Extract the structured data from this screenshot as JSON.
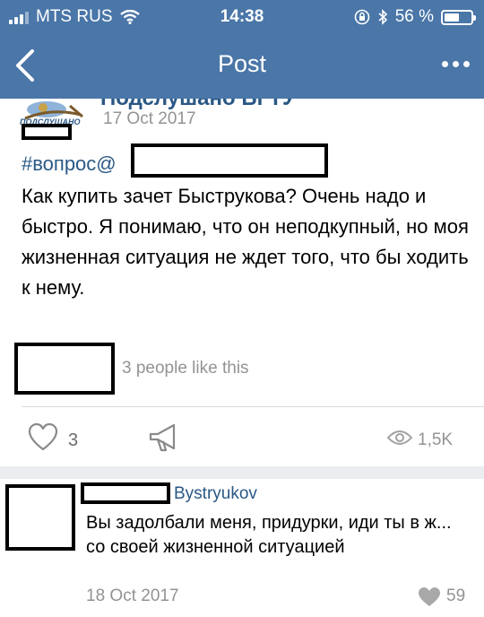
{
  "status_bar": {
    "carrier": "MTS RUS",
    "time": "14:38",
    "battery_percent": "56 %",
    "battery_level": 0.56
  },
  "navbar": {
    "title": "Post"
  },
  "post": {
    "group_name": "Подслушано БГТУ",
    "logo_text": "ПОДСЛУШАНО",
    "date": "17 Oct 2017",
    "hashtag": "#вопрос@",
    "text": "Как купить зачет Быструкова? Очень надо и быстро. Я понимаю, что он неподкупный, но моя жизненная ситуация не ждет того, что бы ходить к нему.",
    "likes_text": "3 people like this",
    "like_count": "3",
    "view_count": "1,5K"
  },
  "comment": {
    "reply_to": "Bystryukov",
    "text": "Вы задолбали меня, придурки, иди ты в ж... со своей жизненной ситуацией",
    "date": "18 Oct 2017",
    "likes": "59"
  },
  "colors": {
    "header": "#4a76a8",
    "link": "#2a5885",
    "muted": "#939393",
    "separator": "#ebedf0"
  },
  "icons": [
    "wifi-icon",
    "lock-rotation-icon",
    "bluetooth-icon",
    "battery-icon",
    "back-icon",
    "more-icon",
    "heart-icon",
    "share-icon",
    "eye-icon"
  ]
}
